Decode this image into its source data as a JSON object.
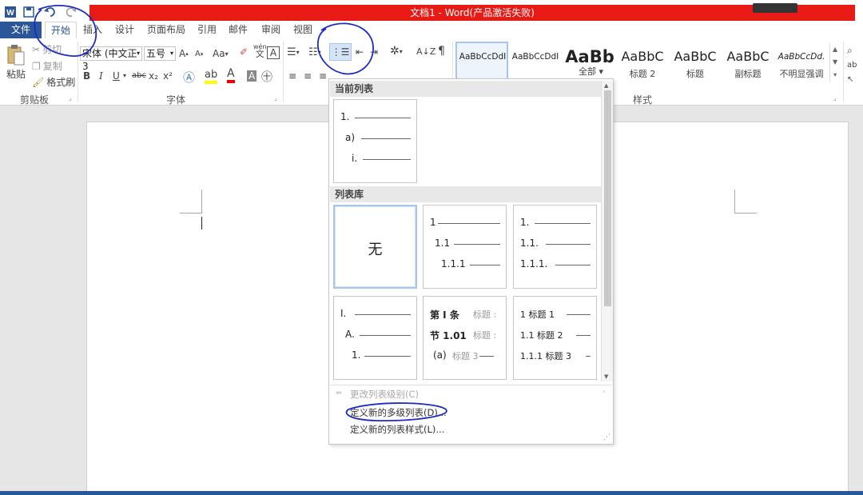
{
  "window": {
    "title": "文档1 - Word(产品激活失败)"
  },
  "tabs": {
    "file": "文件",
    "items": [
      "开始",
      "插入",
      "设计",
      "页面布局",
      "引用",
      "邮件",
      "审阅",
      "视图"
    ],
    "active": "开始"
  },
  "clipboard": {
    "paste": "粘贴",
    "cut": "剪切",
    "copy": "复制",
    "format_painter": "格式刷",
    "group_label": "剪贴板"
  },
  "font": {
    "name": "宋体 (中文正3",
    "size": "五号",
    "grow": "A",
    "shrink": "A",
    "change_case": "Aa",
    "wen": "wén",
    "wen_char": "文",
    "char_border": "A",
    "group_label": "字体",
    "bold": "B",
    "italic": "I",
    "underline": "U",
    "strike": "abc",
    "sub": "x₂",
    "sup": "x²"
  },
  "paragraph": {
    "sort": "A↓Z"
  },
  "styles": {
    "group_label": "样式",
    "items": [
      {
        "preview": "AaBbCcDdI",
        "name": ""
      },
      {
        "preview": "AaBbCcDdI",
        "name": ""
      },
      {
        "preview": "AaBb",
        "name": ""
      },
      {
        "preview": "AaBbC",
        "name": "标题 2"
      },
      {
        "preview": "AaBbC",
        "name": "标题"
      },
      {
        "preview": "AaBbC",
        "name": "副标题"
      },
      {
        "preview": "AaBbCcDd.",
        "name": "不明显强调"
      }
    ]
  },
  "dropdown": {
    "filter": "全部",
    "current_list_header": "当前列表",
    "current_list": [
      "1.",
      "a)",
      "i."
    ],
    "library_header": "列表库",
    "none_label": "无",
    "tiles": [
      {
        "rows": [
          "1",
          "1.1",
          "1.1.1"
        ]
      },
      {
        "rows": [
          "1.",
          "1.1.",
          "1.1.1."
        ]
      },
      {
        "rows": [
          "I.",
          "A.",
          "1."
        ]
      },
      {
        "rows": [
          "第 I 条",
          "节 1.01",
          "(a)"
        ],
        "suffixes": [
          "标题 :",
          "标题 :",
          "标题 3"
        ]
      },
      {
        "rows": [
          "1 标题 1",
          "1.1 标题 2",
          "1.1.1 标题 3"
        ]
      }
    ],
    "change_level": "更改列表级别(C)",
    "define_multilevel": "定义新的多级列表(D)...",
    "define_style": "定义新的列表样式(L)..."
  },
  "colors": {
    "word_blue": "#2b579a",
    "title_red": "#e81a16",
    "annotation": "#1a2cc4"
  }
}
